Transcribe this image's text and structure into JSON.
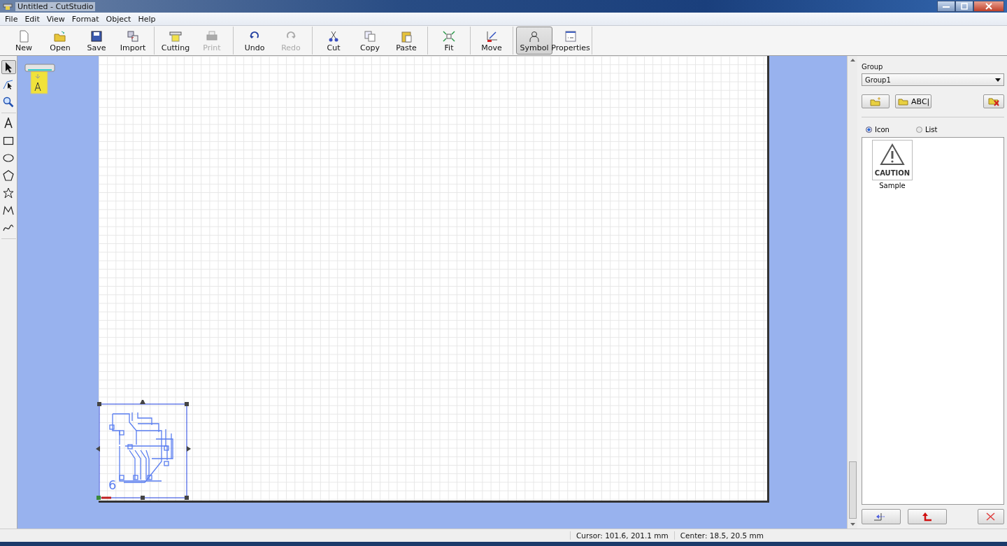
{
  "window": {
    "title": "Untitled - CutStudio"
  },
  "menu": [
    "File",
    "Edit",
    "View",
    "Format",
    "Object",
    "Help"
  ],
  "toolbar": [
    [
      {
        "label": "New",
        "kind": "new",
        "disabled": false,
        "selected": false
      },
      {
        "label": "Open",
        "kind": "open",
        "disabled": false,
        "selected": false
      },
      {
        "label": "Save",
        "kind": "save",
        "disabled": false,
        "selected": false
      },
      {
        "label": "Import",
        "kind": "import",
        "disabled": false,
        "selected": false
      }
    ],
    [
      {
        "label": "Cutting",
        "kind": "cutting",
        "disabled": false,
        "selected": false
      },
      {
        "label": "Print",
        "kind": "print",
        "disabled": true,
        "selected": false
      }
    ],
    [
      {
        "label": "Undo",
        "kind": "undo",
        "disabled": false,
        "selected": false
      },
      {
        "label": "Redo",
        "kind": "redo",
        "disabled": true,
        "selected": false
      }
    ],
    [
      {
        "label": "Cut",
        "kind": "cut",
        "disabled": false,
        "selected": false
      },
      {
        "label": "Copy",
        "kind": "copy",
        "disabled": false,
        "selected": false
      },
      {
        "label": "Paste",
        "kind": "paste",
        "disabled": false,
        "selected": false
      }
    ],
    [
      {
        "label": "Fit",
        "kind": "fit",
        "disabled": false,
        "selected": false
      }
    ],
    [
      {
        "label": "Move",
        "kind": "move",
        "disabled": false,
        "selected": false
      }
    ],
    [
      {
        "label": "Symbol",
        "kind": "symbol",
        "disabled": false,
        "selected": true
      },
      {
        "label": "Properties",
        "kind": "properties",
        "disabled": false,
        "selected": false
      }
    ]
  ],
  "tools": [
    [
      {
        "kind": "select",
        "selected": true
      },
      {
        "kind": "node",
        "selected": false
      },
      {
        "kind": "zoom",
        "selected": false
      }
    ],
    [
      {
        "kind": "text",
        "selected": false
      },
      {
        "kind": "rectangle",
        "selected": false
      },
      {
        "kind": "ellipse",
        "selected": false
      },
      {
        "kind": "polygon",
        "selected": false
      },
      {
        "kind": "star",
        "selected": false
      },
      {
        "kind": "polyline",
        "selected": false
      },
      {
        "kind": "curve",
        "selected": false
      }
    ]
  ],
  "canvas": {
    "object_text": "6"
  },
  "panel": {
    "label": "Group",
    "dropdown": {
      "value": "Group1"
    },
    "group_buttons": [
      {
        "kind": "new-folder"
      },
      {
        "kind": "rename",
        "label": "ABC|"
      },
      {
        "kind": "delete-folder"
      }
    ],
    "view_options": [
      {
        "label": "Icon",
        "selected": true
      },
      {
        "label": "List",
        "selected": false
      }
    ],
    "symbols": [
      {
        "label": "Sample",
        "artwork_text": "CAUTION",
        "selected": false
      }
    ],
    "bottom_buttons": [
      {
        "kind": "insert"
      },
      {
        "kind": "up"
      },
      {
        "kind": "delete"
      }
    ]
  },
  "status_bar": [
    "Cursor: 101.6, 201.1 mm",
    "Center: 18.5, 20.5 mm"
  ]
}
